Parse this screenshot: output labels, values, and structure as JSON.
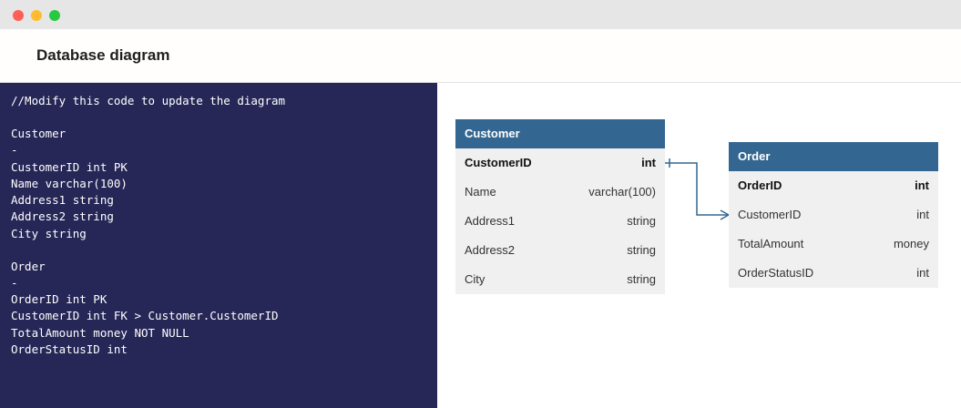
{
  "window": {
    "controls": [
      "close",
      "minimize",
      "maximize"
    ],
    "title": "Database diagram"
  },
  "editor": {
    "lines": [
      "//Modify this code to update the diagram",
      "",
      "Customer",
      "-",
      "CustomerID int PK",
      "Name varchar(100)",
      "Address1 string",
      "Address2 string",
      "City string",
      "",
      "Order",
      "-",
      "OrderID int PK",
      "CustomerID int FK > Customer.CustomerID",
      "TotalAmount money NOT NULL",
      "OrderStatusID int"
    ]
  },
  "diagram": {
    "colors": {
      "header": "#336791",
      "body": "#f0f0f0",
      "connector": "#336791"
    },
    "tables": [
      {
        "name": "Customer",
        "fields": [
          {
            "name": "CustomerID",
            "type": "int",
            "pk": true
          },
          {
            "name": "Name",
            "type": "varchar(100)",
            "pk": false
          },
          {
            "name": "Address1",
            "type": "string",
            "pk": false
          },
          {
            "name": "Address2",
            "type": "string",
            "pk": false
          },
          {
            "name": "City",
            "type": "string",
            "pk": false
          }
        ]
      },
      {
        "name": "Order",
        "fields": [
          {
            "name": "OrderID",
            "type": "int",
            "pk": true
          },
          {
            "name": "CustomerID",
            "type": "int",
            "pk": false
          },
          {
            "name": "TotalAmount",
            "type": "money",
            "pk": false
          },
          {
            "name": "OrderStatusID",
            "type": "int",
            "pk": false
          }
        ]
      }
    ],
    "relationship": {
      "from": "Customer.CustomerID",
      "to": "Order.CustomerID",
      "type": "one-to-many"
    }
  }
}
